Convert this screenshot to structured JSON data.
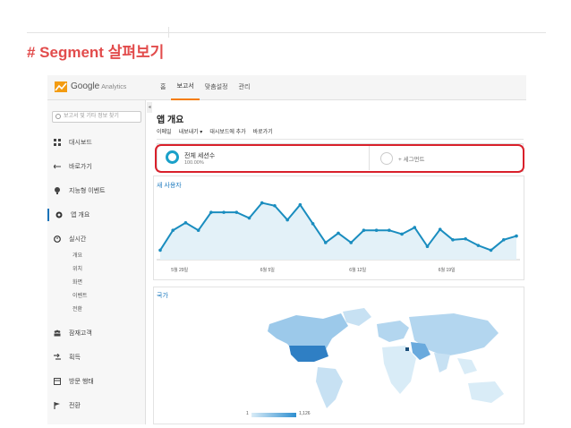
{
  "slide": {
    "title": "# Segment 살펴보기"
  },
  "header": {
    "brand": "Google",
    "brand_sub": "Analytics",
    "tabs": [
      {
        "label": "홈"
      },
      {
        "label": "보고서"
      },
      {
        "label": "맞춤설정"
      },
      {
        "label": "관리"
      }
    ],
    "active_tab": "보고서"
  },
  "sidebar": {
    "search_placeholder": "보고서 및 기타 정보 찾기",
    "items": [
      {
        "label": "대시보드",
        "icon": "grid-icon"
      },
      {
        "label": "바로가기",
        "icon": "arrow-icon"
      },
      {
        "label": "지능형 이벤트",
        "icon": "bulb-icon"
      },
      {
        "label": "앱 개요",
        "icon": "app-overview-icon"
      },
      {
        "label": "실시간",
        "icon": "clock-icon"
      },
      {
        "label": "잠재고객",
        "icon": "people-icon"
      },
      {
        "label": "획득",
        "icon": "acquisition-icon"
      },
      {
        "label": "방문 행태",
        "icon": "behavior-icon"
      },
      {
        "label": "전환",
        "icon": "flag-icon"
      }
    ],
    "realtime_sub": [
      "개요",
      "위치",
      "화면",
      "이벤트",
      "전환"
    ],
    "active_item": "앱 개요"
  },
  "main": {
    "heading": "앱 개요",
    "toolbar": [
      "이메일",
      "내보내기 ▾",
      "대시보드에 추가",
      "바로가기"
    ],
    "segment": {
      "name": "전체 세션수",
      "percent": "100.00%",
      "add_label": "+ 세그먼트"
    },
    "chart_title": "새 사용자",
    "map_title": "국가",
    "map_legend_min": "1",
    "map_legend_max": "1,126"
  },
  "colors": {
    "slide_title": "#e24c4c",
    "highlight_border": "#d9202b",
    "line": "#1a8dbf",
    "area": "#e3f1f8",
    "link_blue": "#1f7bbf"
  },
  "chart_data": {
    "type": "area",
    "title": "새 사용자",
    "x_tick_labels": [
      "5월 29일",
      "6월 5일",
      "6월 12일",
      "6월 19일"
    ],
    "series": [
      {
        "values": [
          10,
          31,
          39,
          31,
          50,
          50,
          50,
          44,
          60,
          57,
          42,
          58,
          38,
          18,
          28,
          18,
          31,
          31,
          31,
          27,
          34,
          14,
          32,
          21,
          22,
          15,
          10,
          21,
          25
        ]
      }
    ],
    "ylim": [
      0,
      70
    ],
    "grid": false
  }
}
